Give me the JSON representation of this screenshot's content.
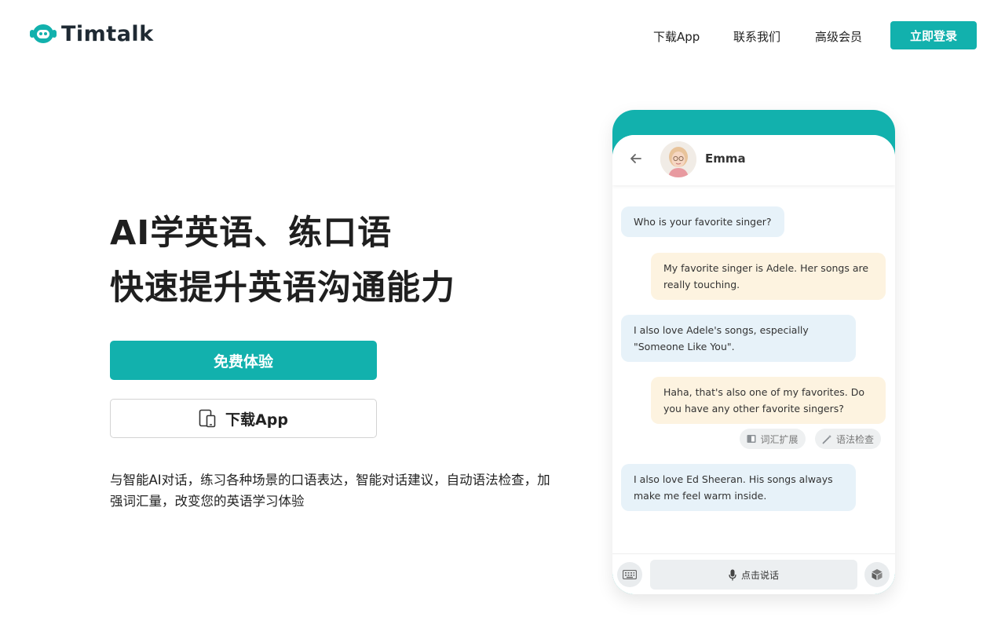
{
  "brand": {
    "name": "Timtalk",
    "accent": "#12b1ad"
  },
  "nav": {
    "download": "下载App",
    "contact": "联系我们",
    "premium": "高级会员",
    "login": "立即登录"
  },
  "hero": {
    "line1": "AI学英语、练口语",
    "line2": "快速提升英语沟通能力",
    "try_button": "免费体验",
    "download_button": "下载App",
    "description": "与智能AI对话，练习各种场景的口语表达，智能对话建议，自动语法检查，加强词汇量，改变您的英语学习体验"
  },
  "chat": {
    "name": "Emma",
    "messages": [
      {
        "role": "ai",
        "text": "Who is your favorite singer?"
      },
      {
        "role": "me",
        "text": "My favorite singer is Adele. Her songs are really touching."
      },
      {
        "role": "ai",
        "text": "I also love Adele's songs, especially \"Someone Like You\"."
      },
      {
        "role": "me",
        "text": "Haha, that's also one of my favorites. Do you have any other favorite singers?"
      },
      {
        "role": "ai",
        "text": "I also love Ed Sheeran. His songs always make me feel warm inside."
      }
    ],
    "chips": {
      "vocab": "词汇扩展",
      "grammar": "语法检查"
    },
    "talk_button": "点击说话"
  },
  "icons": [
    "robot-logo-icon",
    "tablet-phone-icon",
    "back-arrow-icon",
    "book-icon",
    "magic-wand-icon",
    "keyboard-icon",
    "microphone-icon",
    "cube-icon"
  ]
}
